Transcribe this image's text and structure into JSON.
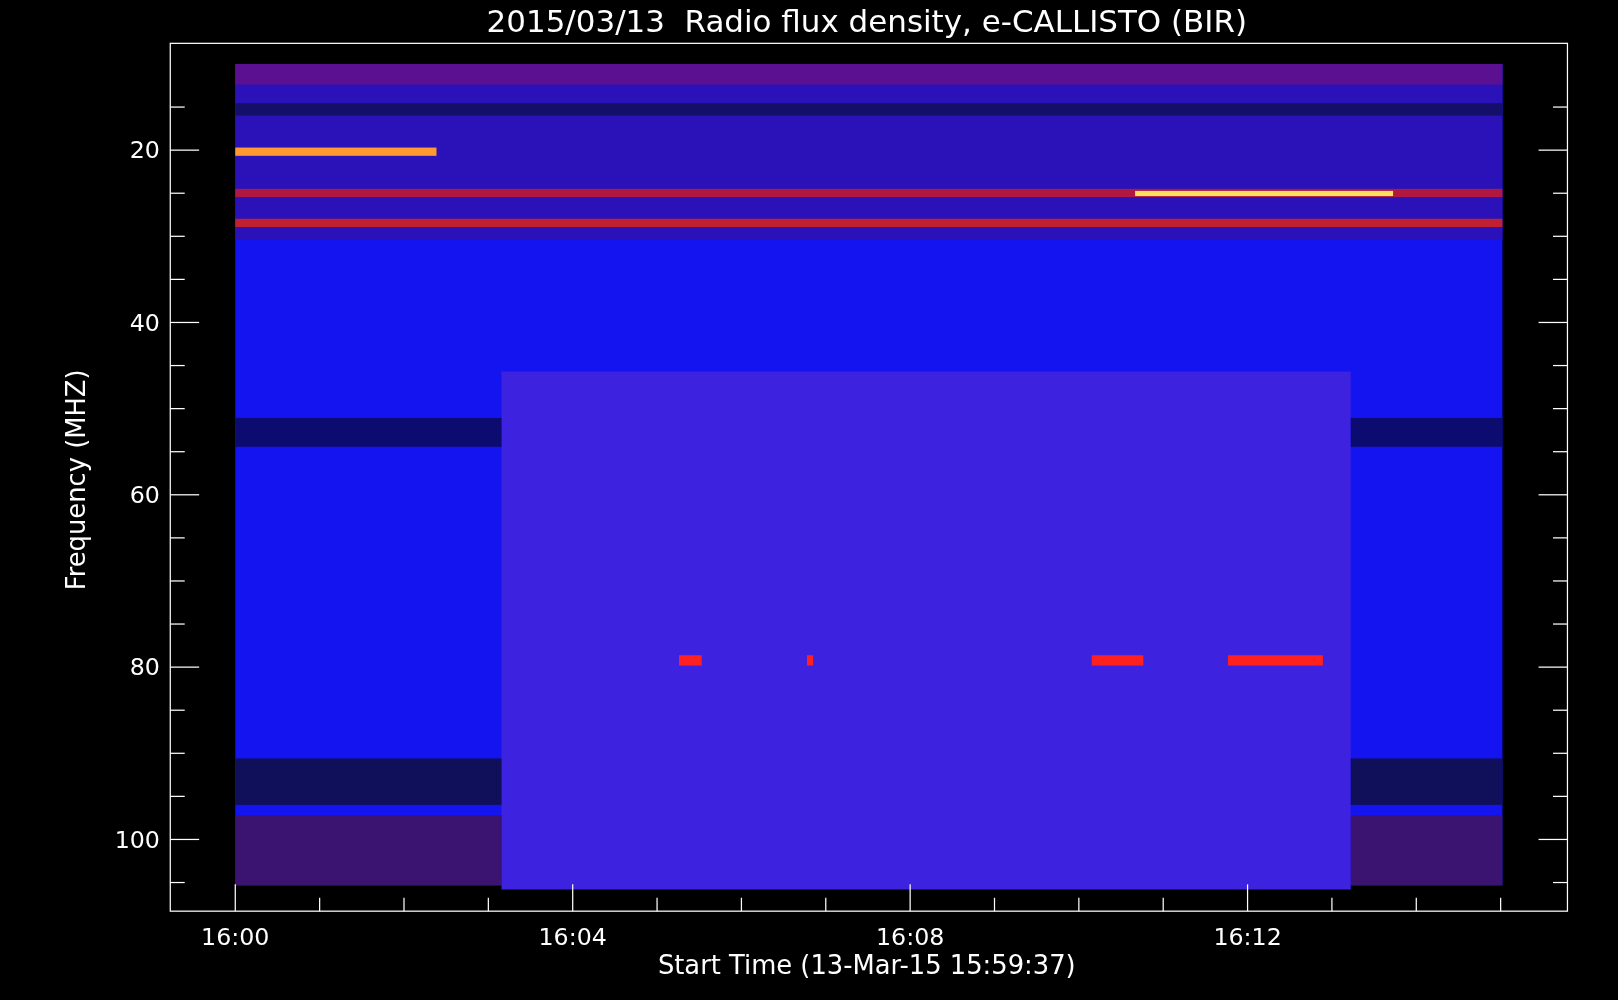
{
  "title": "2015/03/13  Radio flux density, e-CALLISTO (BIR)",
  "y_axis": {
    "title": "Frequency (MHZ)",
    "ticks": [
      "20",
      "40",
      "60",
      "80",
      "100"
    ]
  },
  "x_axis": {
    "title": "Start Time (13-Mar-15 15:59:37)",
    "ticks": [
      "16:00",
      "16:04",
      "16:08",
      "16:12"
    ]
  }
}
